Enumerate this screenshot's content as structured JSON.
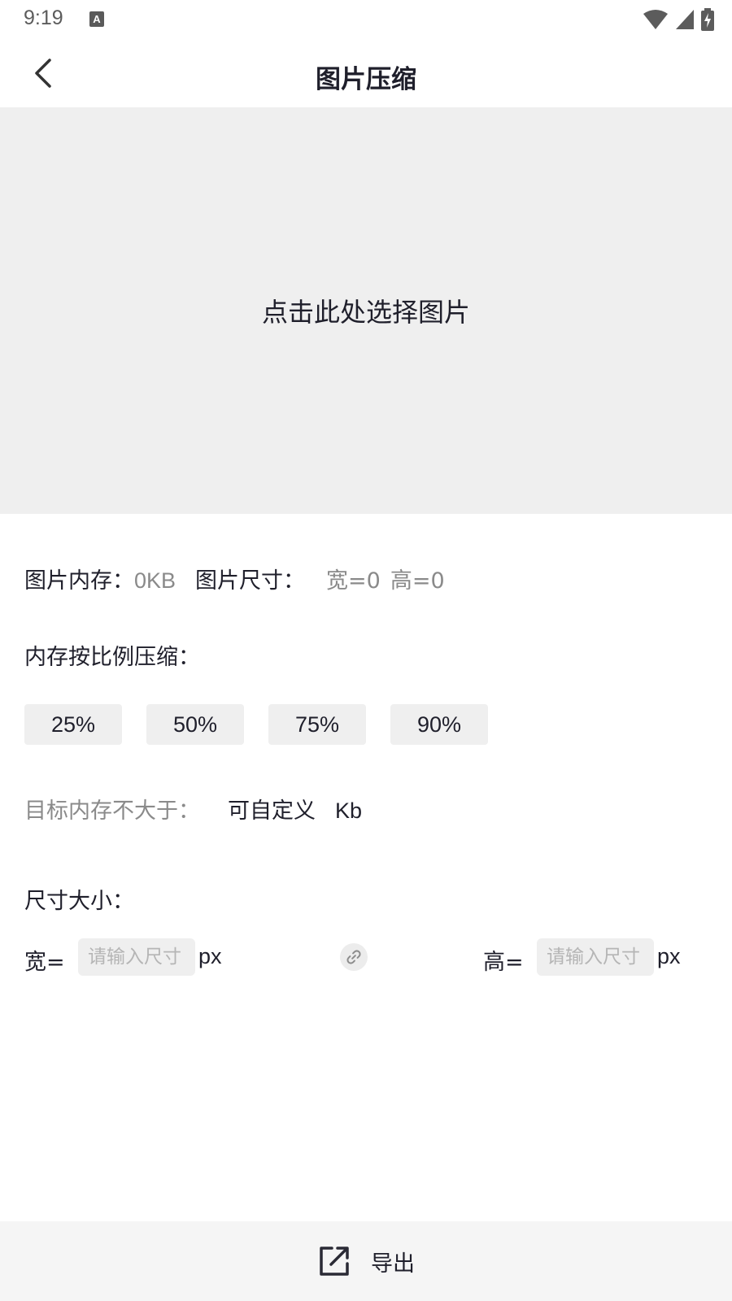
{
  "status_bar": {
    "time": "9:19",
    "notification_icon": "a-icon",
    "icons": [
      "wifi-icon",
      "signal-icon",
      "battery-charging-icon"
    ]
  },
  "header": {
    "back_icon": "chevron-left-icon",
    "title": "图片压缩"
  },
  "image_area": {
    "hint": "点击此处选择图片"
  },
  "info": {
    "memory_label": "图片内存：",
    "memory_value": "0KB",
    "size_label": "图片尺寸：",
    "width_value": "宽=0",
    "height_value": "高=0"
  },
  "ratio": {
    "label": "内存按比例压缩：",
    "options": [
      "25%",
      "50%",
      "75%",
      "90%"
    ]
  },
  "target": {
    "label": "目标内存不大于：",
    "input_placeholder": "可自定义",
    "unit": "Kb"
  },
  "dimension": {
    "label": "尺寸大小：",
    "width_label": "宽=",
    "height_label": "高=",
    "placeholder": "请输入尺寸",
    "unit": "px",
    "link_icon": "link-icon"
  },
  "bottom": {
    "export_icon": "export-icon",
    "export_label": "导出"
  },
  "colors": {
    "background": "#ffffff",
    "panel": "#efefef",
    "text_primary": "#1f1f2b",
    "text_secondary": "#8a8a8a",
    "placeholder": "#b5b5b5"
  }
}
